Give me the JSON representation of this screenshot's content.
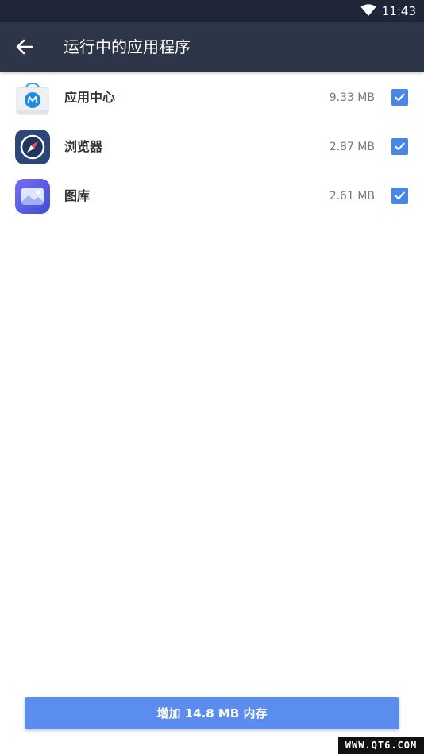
{
  "status_bar": {
    "time": "11:43",
    "wifi_icon": "wifi-icon",
    "background": "#1f2637"
  },
  "app_bar": {
    "back_icon": "arrow-back-icon",
    "title": "运行中的应用程序",
    "background": "#2d3549"
  },
  "apps": [
    {
      "name": "应用中心",
      "size": "9.33 MB",
      "checked": true,
      "icon": "app-center-icon"
    },
    {
      "name": "浏览器",
      "size": "2.87 MB",
      "checked": true,
      "icon": "browser-compass-icon"
    },
    {
      "name": "图库",
      "size": "2.61 MB",
      "checked": true,
      "icon": "gallery-icon"
    }
  ],
  "action_button": {
    "label": "增加 14.8 MB 内存",
    "color": "#5b8def"
  },
  "watermark": "WWW.QT6.COM",
  "accent_color": "#4a86e8"
}
